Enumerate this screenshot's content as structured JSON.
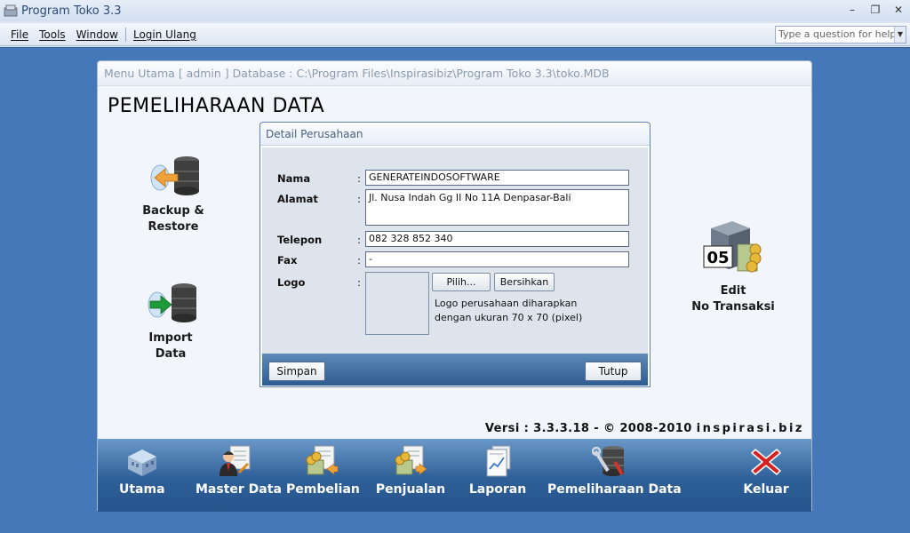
{
  "app": {
    "title": "Program Toko 3.3"
  },
  "menubar": {
    "items": [
      {
        "label": "File"
      },
      {
        "label": "Tools"
      },
      {
        "label": "Window"
      },
      {
        "label": "Login Ulang"
      }
    ],
    "help_placeholder": "Type a question for help"
  },
  "window": {
    "caption": "Menu Utama [ admin ] Database : C:\\Program Files\\Inspirasibiz\\Program Toko 3.3\\toko.MDB",
    "page_title": "PEMELIHARAAN DATA"
  },
  "side_actions": [
    {
      "line1": "Backup &",
      "line2": "Restore",
      "icon": "backup-restore-icon"
    },
    {
      "line1": "Import",
      "line2": "Data",
      "icon": "import-data-icon"
    },
    {
      "line1": "Edit",
      "line2": "No Transaksi",
      "icon": "edit-transaction-icon",
      "badge": "05"
    }
  ],
  "dialog": {
    "title": "Detail Perusahaan",
    "fields": [
      {
        "label": "Nama",
        "value": "GENERATEINDOSOFTWARE"
      },
      {
        "label": "Alamat",
        "value": "Jl. Nusa Indah Gg II No 11A Denpasar-Bali"
      },
      {
        "label": "Telepon",
        "value": "082 328 852 340"
      },
      {
        "label": "Fax",
        "value": "-"
      }
    ],
    "logo_label": "Logo",
    "colon": ":",
    "pilih_label": "Pilih...",
    "bersihkan_label": "Bersihkan",
    "logo_note": "Logo perusahaan diharapkan dengan ukuran 70 x 70 (pixel)",
    "simpan_label": "Simpan",
    "tutup_label": "Tutup"
  },
  "footer": {
    "version_text": "Versi : 3.3.3.18 -  ©  2008-2010",
    "site": "inspirasi.biz"
  },
  "bottom_nav": [
    {
      "label": "Utama",
      "icon": "home-building-icon"
    },
    {
      "label": "Master Data",
      "icon": "master-data-icon"
    },
    {
      "label": "Pembelian",
      "icon": "purchase-icon"
    },
    {
      "label": "Penjualan",
      "icon": "sales-icon"
    },
    {
      "label": "Laporan",
      "icon": "report-icon"
    },
    {
      "label": "Pemeliharaan Data",
      "icon": "maintenance-icon"
    },
    {
      "label": "Keluar",
      "icon": "exit-x-icon"
    }
  ],
  "colors": {
    "accent": "#2e5f97",
    "mdi_bg": "#4478b8",
    "exit_red": "#d92020"
  }
}
